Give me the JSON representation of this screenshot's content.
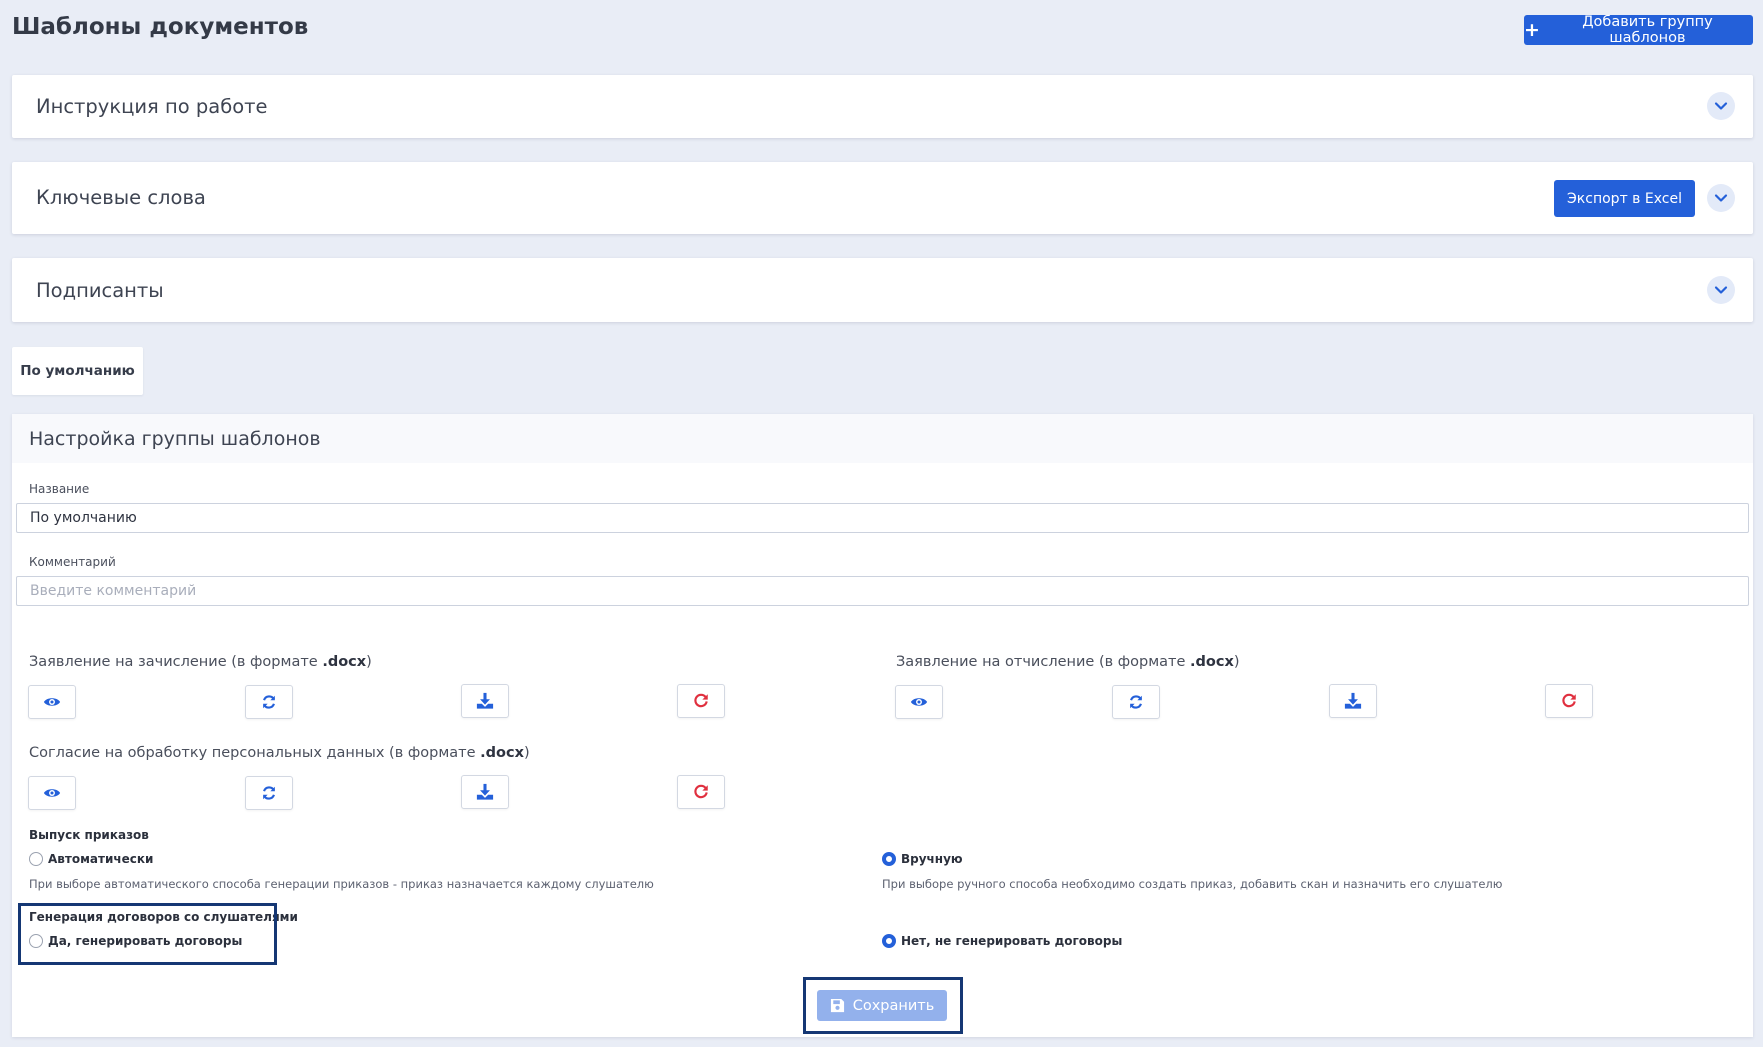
{
  "header": {
    "title": "Шаблоны документов",
    "add_group_icon": "plus-icon",
    "add_group_label": "Добавить группу шаблонов"
  },
  "accordions": {
    "instructions": {
      "title": "Инструкция по работе"
    },
    "keywords": {
      "title": "Ключевые слова",
      "export_label": "Экспорт в Excel"
    },
    "signers": {
      "title": "Подписанты"
    }
  },
  "tabs": {
    "default_label": "По умолчанию"
  },
  "panel": {
    "title": "Настройка группы шаблонов",
    "name_label": "Название",
    "name_value": "По умолчанию",
    "comment_label": "Комментарий",
    "comment_placeholder": "Введите комментарий"
  },
  "documents": {
    "enroll": {
      "title_text": "Заявление на зачисление (в формате ",
      "format": ".docx",
      "close": ")"
    },
    "expel": {
      "title_text": "Заявление на отчисление (в формате ",
      "format": ".docx",
      "close": ")"
    },
    "consent": {
      "title_text": "Согласие на обработку персональных данных (в формате ",
      "format": ".docx",
      "close": ")"
    },
    "action_icons": [
      "eye-icon",
      "refresh-icon",
      "download-icon",
      "reset-icon"
    ]
  },
  "orders": {
    "title": "Выпуск приказов",
    "auto_label": "Автоматически",
    "auto_hint": "При выборе автоматического способа генерации приказов - приказ назначается каждому слушателю",
    "manual_label": "Вручную",
    "manual_hint": "При выборе ручного способа необходимо создать приказ, добавить скан и назначить его слушателю",
    "selected": "manual"
  },
  "contracts": {
    "title": "Генерация договоров со слушателями",
    "yes_label": "Да, генерировать договоры",
    "no_label": "Нет, не генерировать договоры",
    "selected": "no"
  },
  "save": {
    "label": "Сохранить",
    "icon": "floppy-disk-icon"
  },
  "colors": {
    "primary": "#2460d9",
    "danger": "#e0303f",
    "save_disabled": "#93b1ec",
    "highlight": "#153774"
  }
}
